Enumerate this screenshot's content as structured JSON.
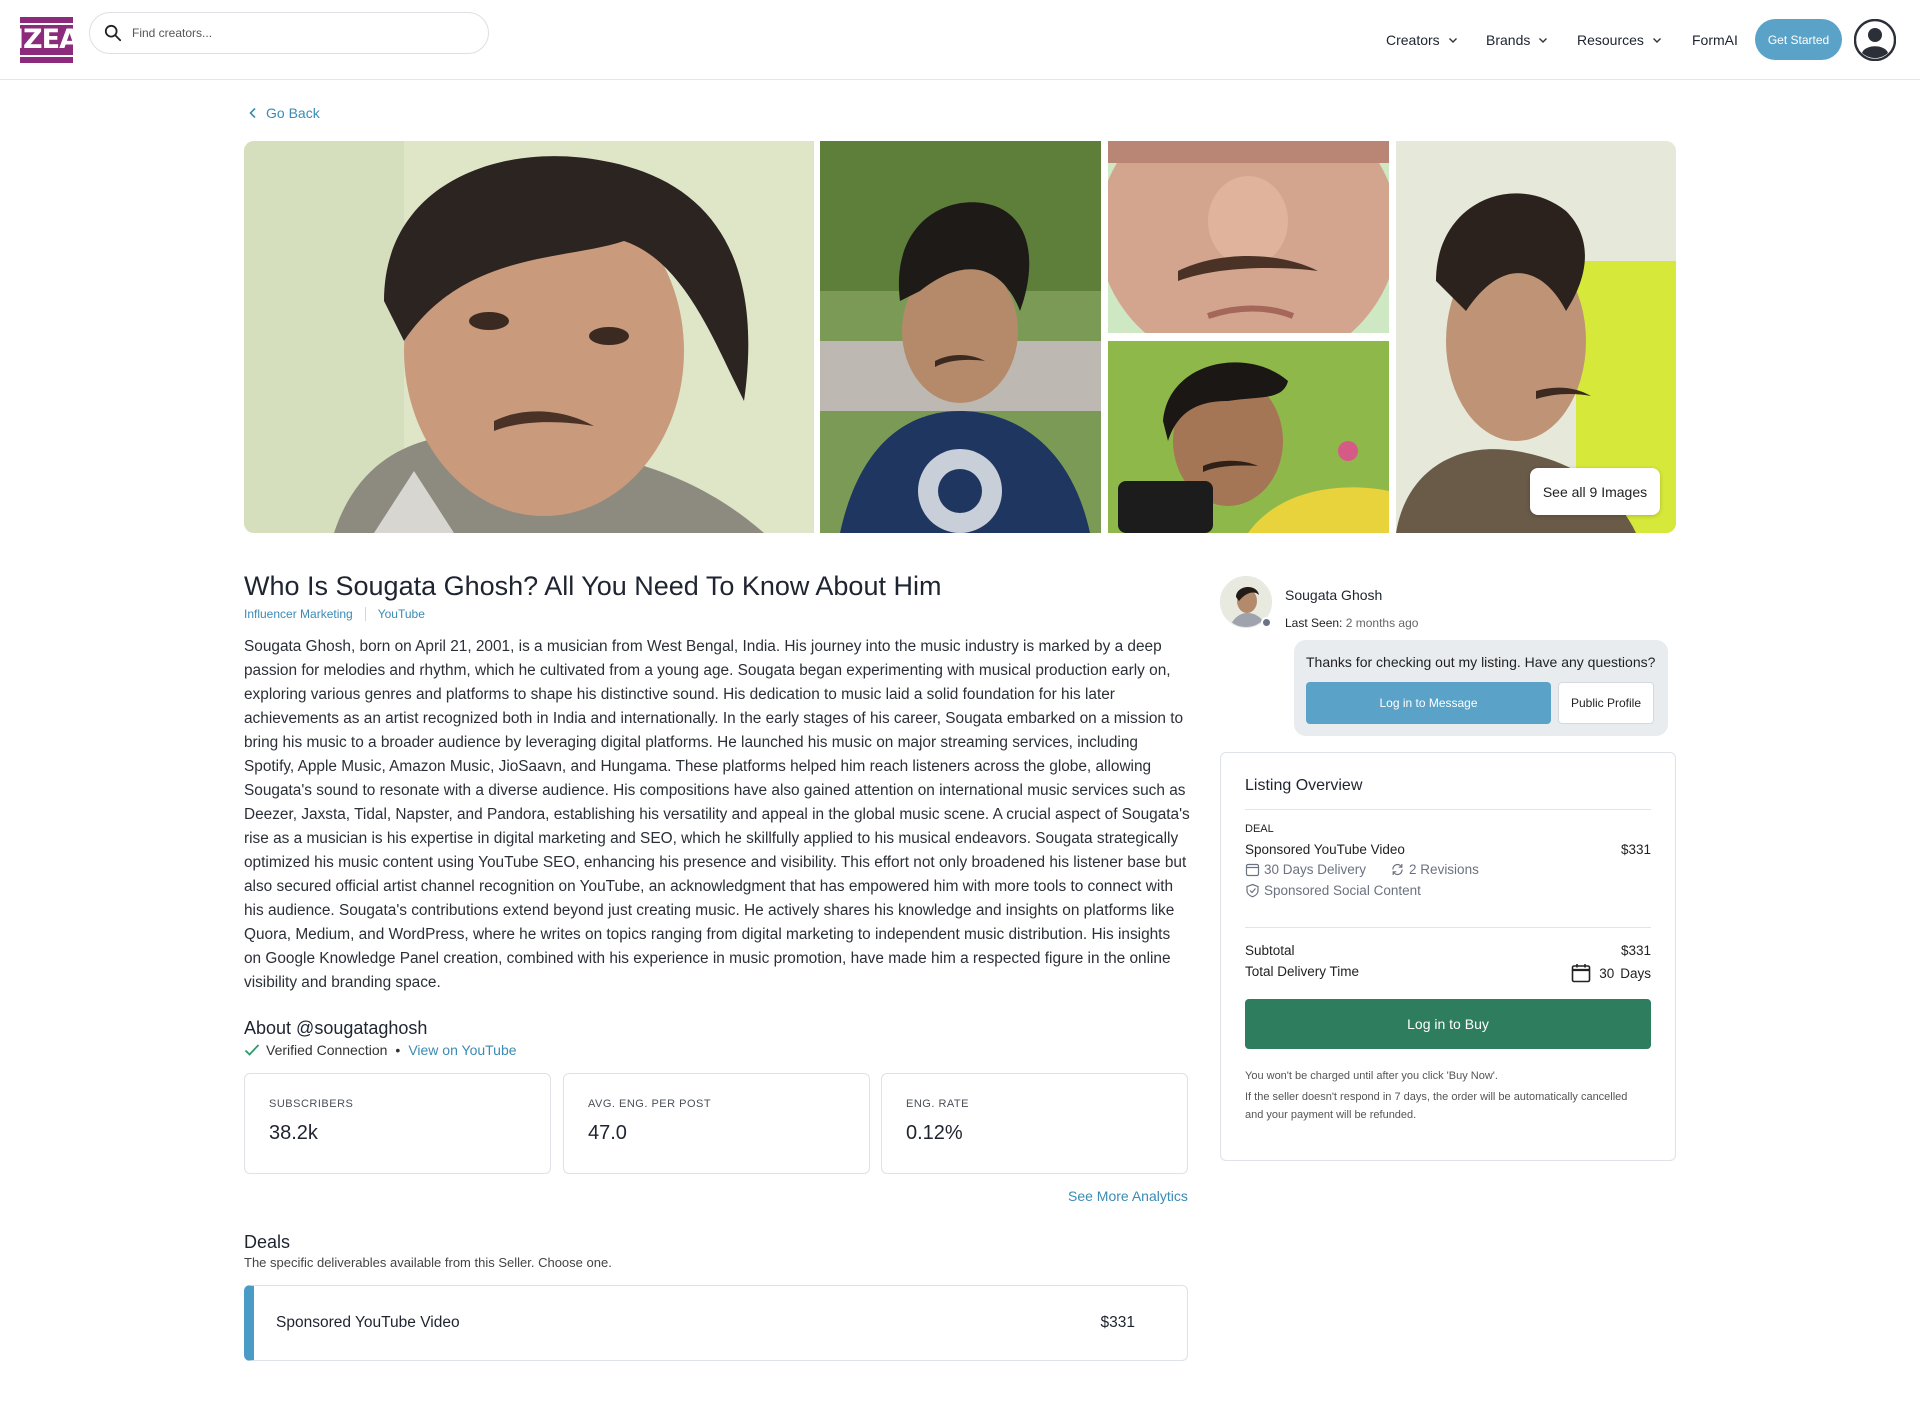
{
  "header": {
    "logo_text": "IZEA",
    "search_placeholder": "Find creators...",
    "nav": [
      {
        "label": "Creators",
        "has_menu": true
      },
      {
        "label": "Brands",
        "has_menu": true
      },
      {
        "label": "Resources",
        "has_menu": true
      },
      {
        "label": "FormAI",
        "has_menu": false
      }
    ],
    "cta_label": "Get Started",
    "avatar_icon": "user-avatar-icon"
  },
  "go_back_label": "Go Back",
  "gallery": {
    "see_all_label": "See all 9 Images"
  },
  "listing": {
    "title": "Who Is Sougata Ghosh? All You Need To Know About Him",
    "tags": [
      "Influencer Marketing",
      "YouTube"
    ],
    "description": "Sougata Ghosh, born on April 21, 2001, is a musician from West Bengal, India. His journey into the music industry is marked by a deep passion for melodies and rhythm, which he cultivated from a young age. Sougata began experimenting with musical production early on, exploring various genres and platforms to shape his distinctive sound. His dedication to music laid a solid foundation for his later achievements as an artist recognized both in India and internationally. In the early stages of his career, Sougata embarked on a mission to bring his music to a broader audience by leveraging digital platforms. He launched his music on major streaming services, including Spotify, Apple Music, Amazon Music, JioSaavn, and Hungama. These platforms helped him reach listeners across the globe, allowing Sougata's sound to resonate with a diverse audience. His compositions have also gained attention on international music services such as Deezer, Jaxsta, Tidal, Napster, and Pandora, establishing his versatility and appeal in the global music scene. A crucial aspect of Sougata's rise as a musician is his expertise in digital marketing and SEO, which he skillfully applied to his musical endeavors. Sougata strategically optimized his music content using YouTube SEO, enhancing his presence and visibility. This effort not only broadened his listener base but also secured official artist channel recognition on YouTube, an acknowledgment that has empowered him with more tools to connect with his audience. Sougata's contributions extend beyond just creating music. He actively shares his knowledge and insights on platforms like Quora, Medium, and WordPress, where he writes on topics ranging from digital marketing to independent music distribution. His insights on Google Knowledge Panel creation, combined with his experience in music promotion, have made him a respected figure in the online visibility and branding space."
  },
  "about": {
    "heading": "About @sougataghosh",
    "verified_label": "Verified Connection",
    "separator": "•",
    "view_link": "View on YouTube",
    "stats": [
      {
        "label": "SUBSCRIBERS",
        "value": "38.2k"
      },
      {
        "label": "AVG. ENG. PER POST",
        "value": "47.0"
      },
      {
        "label": "ENG. RATE",
        "value": "0.12%"
      }
    ],
    "see_more_label": "See More Analytics"
  },
  "deals": {
    "heading": "Deals",
    "subheading": "The specific deliverables available from this Seller. Choose one.",
    "items": [
      {
        "name": "Sponsored YouTube Video",
        "price": "$331"
      }
    ]
  },
  "seller": {
    "name": "Sougata Ghosh",
    "last_seen_label": "Last Seen:",
    "last_seen_value": "2 months ago",
    "message": "Thanks for checking out my listing. Have any questions?",
    "message_button": "Log in to Message",
    "profile_button": "Public Profile"
  },
  "overview": {
    "title": "Listing Overview",
    "deal_label": "DEAL",
    "deal_name": "Sponsored YouTube Video",
    "deal_price": "$331",
    "delivery": "30 Days Delivery",
    "revisions": "2 Revisions",
    "content_type": "Sponsored Social Content",
    "subtotal_label": "Subtotal",
    "subtotal_value": "$331",
    "delivery_time_label": "Total Delivery Time",
    "delivery_time_value": "30",
    "delivery_time_unit": "Days",
    "buy_label": "Log in to Buy",
    "note1": "You won't be charged until after you click 'Buy Now'.",
    "note2": "If the seller doesn't respond in 7 days, the order will be automatically cancelled and your payment will be refunded."
  },
  "colors": {
    "accent_blue": "#5aa2c8",
    "link_blue": "#3b8bb5",
    "buy_green": "#2e7d5f",
    "brand_purple": "#8c2b7b"
  }
}
